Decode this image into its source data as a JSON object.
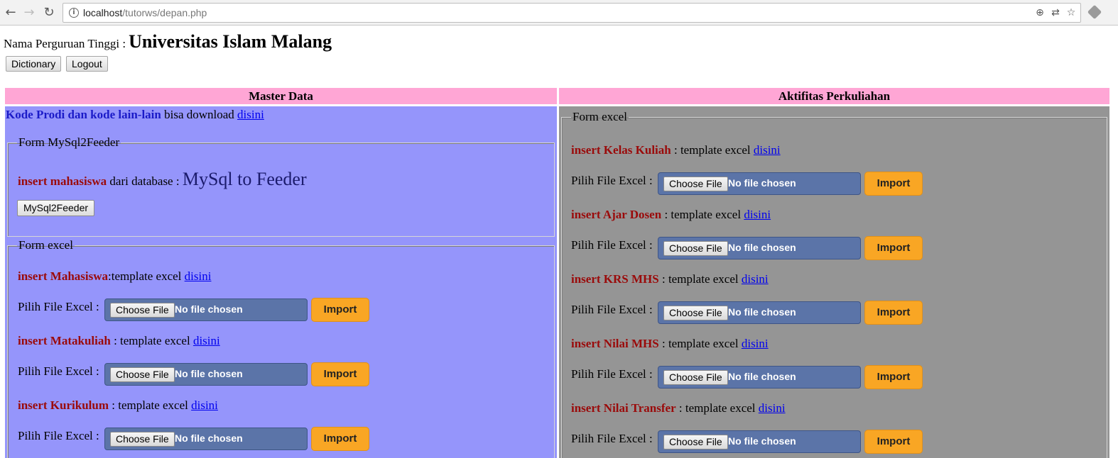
{
  "browser": {
    "url_host": "localhost",
    "url_path": "/tutorws/depan.php",
    "back_icon": "back-arrow-icon",
    "forward_icon": "forward-arrow-icon",
    "reload_icon": "reload-icon"
  },
  "header": {
    "label": "Nama Perguruan Tinggi :",
    "institution": "Universitas Islam Malang",
    "dictionary_button": "Dictionary",
    "logout_button": "Logout"
  },
  "common": {
    "file_label": "Pilih File Excel :",
    "choose_file": "Choose File",
    "no_file": "No file chosen",
    "import": "Import",
    "link": "disini"
  },
  "master": {
    "title": "Master Data",
    "intro_highlight": "Kode Prodi dan kode lain-lain",
    "intro_text": "bisa download",
    "mysql_legend": "Form MySql2Feeder",
    "mysql_insert": "insert mahasiswa",
    "mysql_text": "dari database :",
    "mysql_big": "MySql to Feeder",
    "mysql_button": "MySql2Feeder",
    "excel_legend": "Form excel",
    "items": [
      {
        "title": "insert Mahasiswa",
        "suffix": ":template excel"
      },
      {
        "title": "insert Matakuliah",
        "suffix": " : template excel"
      },
      {
        "title": "insert Kurikulum",
        "suffix": " : template excel"
      }
    ]
  },
  "aktifitas": {
    "title": "Aktifitas Perkuliahan",
    "excel_legend": "Form excel",
    "items": [
      {
        "title": "insert Kelas Kuliah",
        "suffix": " : template excel"
      },
      {
        "title": "insert Ajar Dosen",
        "suffix": " : template excel"
      },
      {
        "title": "insert KRS MHS",
        "suffix": " : template excel"
      },
      {
        "title": "insert Nilai MHS",
        "suffix": " : template excel"
      },
      {
        "title": "insert Nilai Transfer",
        "suffix": " : template excel"
      }
    ]
  }
}
